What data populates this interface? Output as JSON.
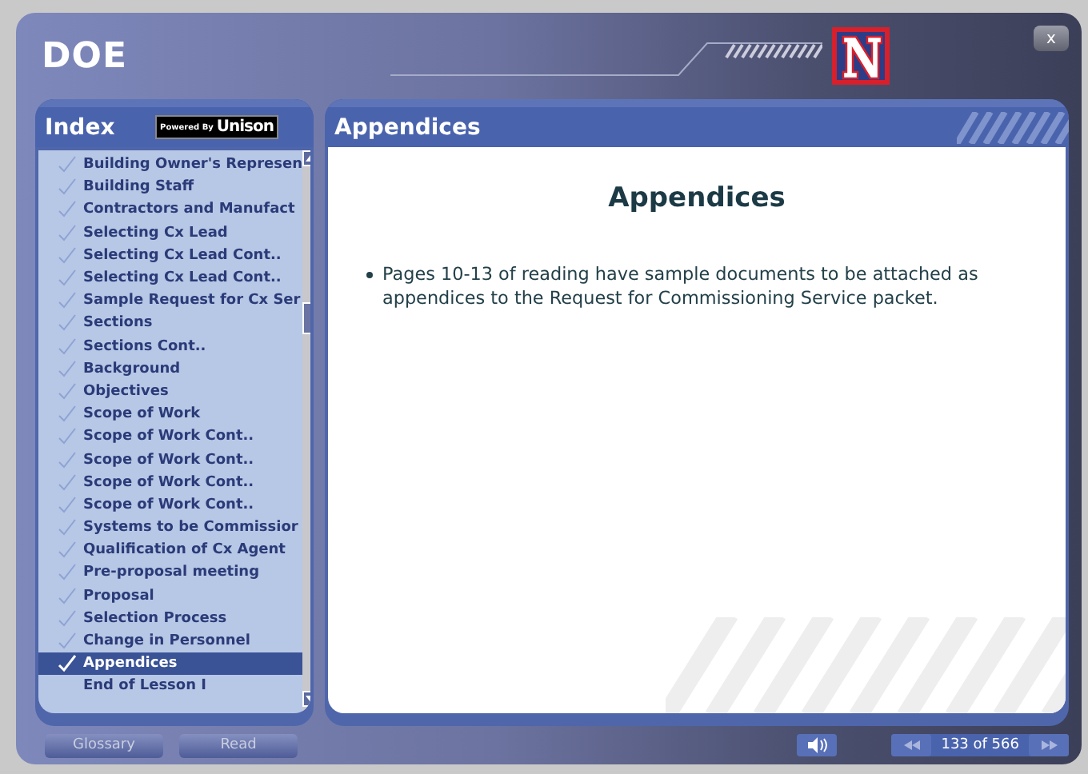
{
  "window": {
    "title": "DOE",
    "close": "x"
  },
  "index": {
    "title": "Index",
    "badge_prefix": "Powered By",
    "badge_brand": "Unison",
    "items": [
      {
        "label": "Building Owner's Represen",
        "visited": true,
        "selected": false
      },
      {
        "label": "Building Staff",
        "visited": true,
        "selected": false
      },
      {
        "label": "Contractors and Manufact",
        "visited": true,
        "selected": false
      },
      {
        "label": "Selecting Cx Lead",
        "visited": true,
        "selected": false
      },
      {
        "label": "Selecting Cx Lead Cont..",
        "visited": true,
        "selected": false
      },
      {
        "label": "Selecting Cx Lead Cont..",
        "visited": true,
        "selected": false
      },
      {
        "label": "Sample Request for Cx Ser",
        "visited": true,
        "selected": false
      },
      {
        "label": "Sections",
        "visited": true,
        "selected": false
      },
      {
        "label": "Sections Cont..",
        "visited": true,
        "selected": false
      },
      {
        "label": "Background",
        "visited": true,
        "selected": false
      },
      {
        "label": "Objectives",
        "visited": true,
        "selected": false
      },
      {
        "label": "Scope of Work",
        "visited": true,
        "selected": false
      },
      {
        "label": "Scope of Work Cont..",
        "visited": true,
        "selected": false
      },
      {
        "label": "Scope of Work Cont..",
        "visited": true,
        "selected": false
      },
      {
        "label": "Scope of Work Cont..",
        "visited": true,
        "selected": false
      },
      {
        "label": "Scope of Work Cont..",
        "visited": true,
        "selected": false
      },
      {
        "label": "Systems to be Commissior",
        "visited": true,
        "selected": false
      },
      {
        "label": "Qualification of Cx Agent",
        "visited": true,
        "selected": false
      },
      {
        "label": "Pre-proposal meeting",
        "visited": true,
        "selected": false
      },
      {
        "label": "Proposal",
        "visited": true,
        "selected": false
      },
      {
        "label": "Selection Process",
        "visited": true,
        "selected": false
      },
      {
        "label": "Change in Personnel",
        "visited": true,
        "selected": false
      },
      {
        "label": "Appendices",
        "visited": true,
        "selected": true
      },
      {
        "label": "End of Lesson I",
        "visited": false,
        "selected": false
      }
    ]
  },
  "content": {
    "header": "Appendices",
    "heading": "Appendices",
    "bullets": [
      "Pages 10-13 of reading have sample documents to be attached as appendices to the Request for Commissioning Service packet."
    ]
  },
  "footer": {
    "buttons": [
      "Glossary",
      "Read"
    ],
    "page": "133 of 566"
  }
}
